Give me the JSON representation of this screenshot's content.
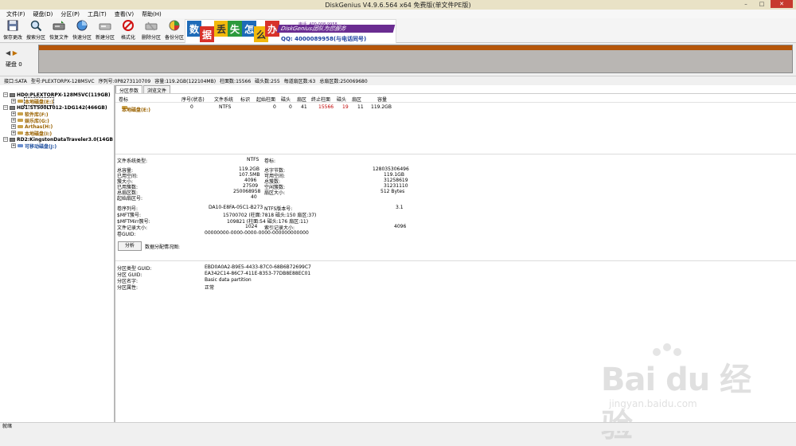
{
  "window": {
    "title": "DiskGenius V4.9.6.564 x64 免费版(单文件PE版)"
  },
  "menu": [
    "文件(F)",
    "硬盘(D)",
    "分区(P)",
    "工具(T)",
    "查看(V)",
    "帮助(H)"
  ],
  "toolbar": [
    {
      "label": "保存更改",
      "icon": "save-icon"
    },
    {
      "label": "搜索分区",
      "icon": "search-partition-icon"
    },
    {
      "label": "恢复文件",
      "icon": "recover-file-icon"
    },
    {
      "label": "快速分区",
      "icon": "quick-partition-icon"
    },
    {
      "label": "新建分区",
      "icon": "new-partition-icon"
    },
    {
      "label": "格式化",
      "icon": "format-icon"
    },
    {
      "label": "删除分区",
      "icon": "delete-partition-icon"
    },
    {
      "label": "备份分区",
      "icon": "backup-partition-icon"
    }
  ],
  "banner": {
    "chars": [
      "数",
      "据",
      "丢",
      "失",
      "怎",
      "么",
      "办"
    ],
    "brand": "DiskGenius团队为您服务",
    "hotline": "电话: 400-008-9958",
    "qq": "QQ: 4000089958(与电话同号)"
  },
  "disk_panel": {
    "label": "硬盘 0"
  },
  "info_line": {
    "iface": "接口:SATA",
    "model": "型号:PLEXTORPX-128M5VC",
    "serial": "序列号:0P8273110709",
    "capacity": "容量:119.2GB(122104MB)",
    "cylinders": "柱面数:15566",
    "heads": "磁头数:255",
    "sectors": "每道扇区数:63",
    "total": "总扇区数:250069680"
  },
  "tree": {
    "hd0": "HD0:PLEXTORPX-128M5VC(119GB)",
    "hd0_part": "本地磁盘(E:)",
    "hd1": "HD1:ST500LT012-1DG142(466GB)",
    "hd1_parts": [
      "软件库(F:)",
      "娱乐库(G:)",
      "Arthas(H:)",
      "本地磁盘(I:)"
    ],
    "hd2": "RD2:KingstonDataTraveler3.0(14GB",
    "hd2_part": "可移动磁盘(J:)"
  },
  "tabs": [
    "分区参数",
    "浏览文件"
  ],
  "partition_table": {
    "headers": [
      "卷标",
      "序号(状态)",
      "文件系统",
      "标识",
      "起始柱面",
      "磁头",
      "扇区",
      "终止柱面",
      "磁头",
      "扇区",
      "容量"
    ],
    "row": [
      "本地磁盘(E:)",
      "0",
      "NTFS",
      "",
      "0",
      "0",
      "41",
      "15566",
      "19",
      "11",
      "119.2GB"
    ]
  },
  "fs_info": {
    "fs_type_label": "文件系统类型:",
    "fs_type": "NTFS",
    "vol_label": "卷标:",
    "left": [
      [
        "总容量:",
        "119.2GB"
      ],
      [
        "已用空间:",
        "107.5MB"
      ],
      [
        "簇大小:",
        "4096"
      ],
      [
        "已用簇数:",
        "27509"
      ],
      [
        "总扇区数:",
        "250068958"
      ],
      [
        "起始扇区号:",
        "40"
      ]
    ],
    "right": [
      [
        "总字节数:",
        "128035306496"
      ],
      [
        "可用空间:",
        "119.1GB"
      ],
      [
        "总簇数:",
        "31258619"
      ],
      [
        "空闲簇数:",
        "31231110"
      ],
      [
        "扇区大小:",
        "512 Bytes"
      ]
    ],
    "serial_label": "卷序列号:",
    "serial": "DA10-E8FA-05C1-B273",
    "ntfs_ver_label": "NTFS版本号:",
    "ntfs_ver": "3.1",
    "mft_label": "$MFT簇号:",
    "mft": "15700702 (柱面:7818 磁头:150 扇区:37)",
    "mftmirr_label": "$MFTMirr簇号:",
    "mftmirr": "109821 (柱面:54 磁头:176 扇区:11)",
    "filerec_label": "文件记录大小:",
    "filerec": "1024",
    "indexrec_label": "索引记录大小:",
    "indexrec": "4096",
    "guid_label": "卷GUID:",
    "guid": "00000000-0000-0000-0000-000000000000"
  },
  "analyze": {
    "button": "分析",
    "label": "数据分配情况图:"
  },
  "gpt": [
    [
      "分区类型 GUID:",
      "EBD0A0A2-B9E5-4433-87C0-68B6B72699C7"
    ],
    [
      "分区 GUID:",
      "EA342C14-86C7-411E-8353-77DB8E88EC01"
    ],
    [
      "分区名字:",
      "Basic data partition"
    ],
    [
      "分区属性:",
      "正常"
    ]
  ],
  "status": "就绪",
  "watermark": {
    "main": "Bai du 经验",
    "sub": "jingyan.baidu.com"
  }
}
